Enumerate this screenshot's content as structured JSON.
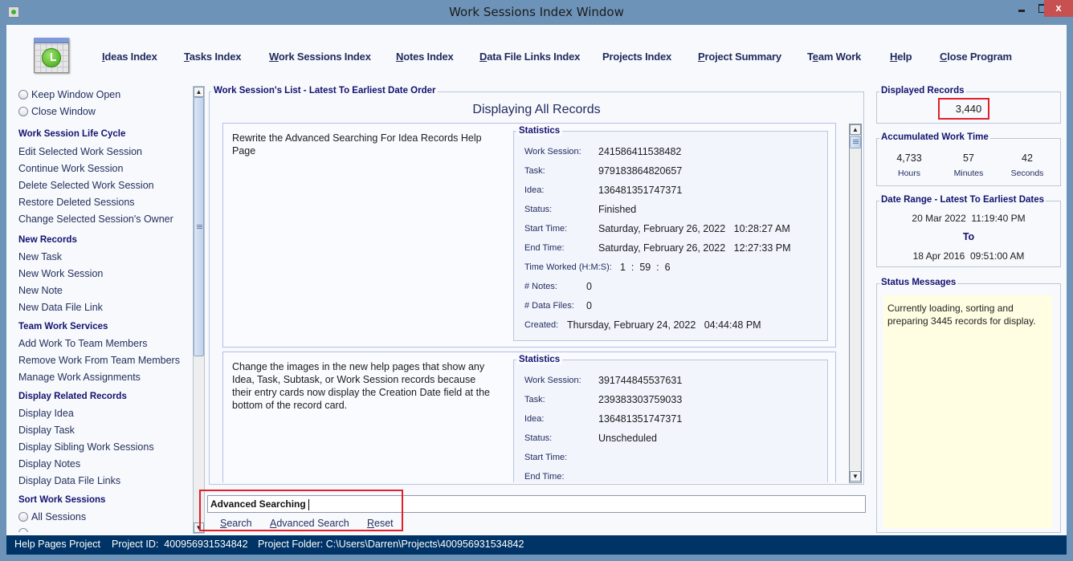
{
  "window": {
    "title": "Work Sessions Index Window",
    "controls": {
      "minimize": "minimize",
      "maximize": "maximize",
      "close": "x"
    }
  },
  "menu": {
    "items": [
      {
        "label": "Ideas Index",
        "mnemonic": "I"
      },
      {
        "label": "Tasks Index",
        "mnemonic": "T"
      },
      {
        "label": "Work Sessions Index",
        "mnemonic": "W"
      },
      {
        "label": "Notes Index",
        "mnemonic": "N"
      },
      {
        "label": "Data File Links Index",
        "mnemonic": "D"
      },
      {
        "label": "Projects Index",
        "mnemonic": ""
      },
      {
        "label": "Project Summary",
        "mnemonic": "P"
      },
      {
        "label": "Team Work",
        "mnemonic": "e"
      },
      {
        "label": "Help",
        "mnemonic": "H"
      },
      {
        "label": "Close Program",
        "mnemonic": "C"
      }
    ]
  },
  "sidebar": {
    "window_options": [
      {
        "label": "Keep Window Open",
        "selected": false
      },
      {
        "label": "Close Window",
        "selected": false
      }
    ],
    "sections": [
      {
        "heading": "Work Session Life Cycle",
        "items": [
          "Edit Selected Work Session",
          "Continue Work Session",
          "Delete Selected Work Session",
          "Restore Deleted Sessions",
          "Change Selected Session's Owner"
        ]
      },
      {
        "heading": "New Records",
        "items": [
          "New Task",
          "New Work Session",
          "New Note",
          "New Data File Link"
        ]
      },
      {
        "heading": "Team Work Services",
        "items": [
          "Add Work To Team Members",
          "Remove Work From Team Members",
          "Manage Work Assignments"
        ]
      },
      {
        "heading": "Display Related Records",
        "items": [
          "Display Idea",
          "Display Task",
          "Display Sibling Work Sessions",
          "Display Notes",
          "Display Data File Links"
        ]
      },
      {
        "heading": "Sort Work Sessions",
        "items": [
          "All Sessions"
        ]
      }
    ]
  },
  "list": {
    "group_title": "Work Session's List - Latest To Earliest Date Order",
    "heading": "Displaying All Records",
    "stats_title": "Statistics",
    "labels": {
      "work_session": "Work Session:",
      "task": "Task:",
      "idea": "Idea:",
      "status": "Status:",
      "start_time": "Start Time:",
      "end_time": "End Time:",
      "time_worked": "Time Worked (H:M:S):",
      "notes": "# Notes:",
      "data_files": "# Data Files:",
      "created": "Created:"
    },
    "records": [
      {
        "description": "Rewrite the Advanced Searching For Idea Records Help Page",
        "work_session": "241586411538482",
        "task": "979183864820657",
        "idea": "136481351747371",
        "status": "Finished",
        "start_time": "Saturday, February 26, 2022   10:28:27 AM",
        "end_time": "Saturday, February 26, 2022   12:27:33 PM",
        "time_worked": "1  :  59  :  6",
        "notes": "0",
        "data_files": "0",
        "created": "Thursday, February 24, 2022   04:44:48 PM"
      },
      {
        "description": "Change the images in the new help pages that show any Idea, Task, Subtask, or Work Session records because their entry cards now display the Creation Date field at the bottom of the record card.",
        "work_session": "391744845537631",
        "task": "239383303759033",
        "idea": "136481351747371",
        "status": "Unscheduled",
        "start_time": "",
        "end_time": ""
      }
    ]
  },
  "search": {
    "value": "Advanced Searching",
    "buttons": [
      {
        "label": "Search",
        "mnemonic": "S"
      },
      {
        "label": "Advanced Search",
        "mnemonic": "A"
      },
      {
        "label": "Reset",
        "mnemonic": "R"
      }
    ]
  },
  "right_panel": {
    "displayed_records": {
      "title": "Displayed Records",
      "value": "3,440"
    },
    "accumulated_time": {
      "title": "Accumulated Work Time",
      "hours": "4,733",
      "hours_label": "Hours",
      "minutes": "57",
      "minutes_label": "Minutes",
      "seconds": "42",
      "seconds_label": "Seconds"
    },
    "date_range": {
      "title": "Date Range - Latest To Earliest Dates",
      "latest": "20 Mar 2022  11:19:40 PM",
      "to": "To",
      "earliest": "18 Apr 2016  09:51:00 AM"
    },
    "status_messages": {
      "title": "Status Messages",
      "text": "Currently loading, sorting and preparing 3445 records for display."
    }
  },
  "statusbar": {
    "project": "Help Pages Project",
    "project_id": "Project ID:  400956931534842",
    "project_folder": "Project Folder: C:\\Users\\Darren\\Projects\\400956931534842"
  },
  "colors": {
    "titlebar": "#6d93b8",
    "statusbar": "#003466",
    "heading_text": "#12126e",
    "highlight_box": "#e0202a",
    "status_bg": "#fffee2",
    "close_button": "#c75050"
  }
}
